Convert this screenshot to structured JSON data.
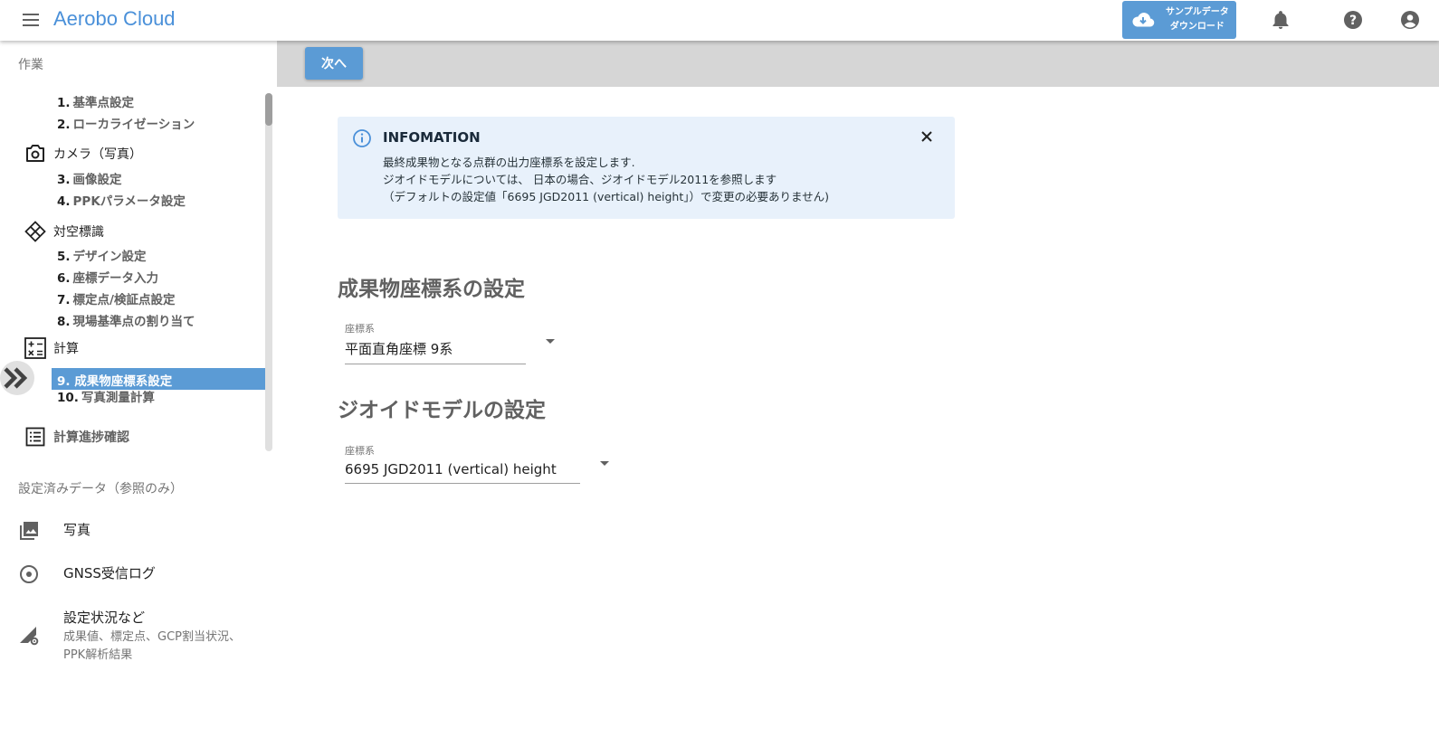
{
  "header": {
    "app_title": "Aerobo Cloud",
    "download_line1": "サンプルデータ",
    "download_line2": "ダウンロード"
  },
  "sidebar": {
    "work_label": "作業",
    "steps": [
      {
        "num": "1.",
        "label": "基準点設定"
      },
      {
        "num": "2.",
        "label": "ローカライゼーション"
      },
      {
        "num": "3.",
        "label": "画像設定"
      },
      {
        "num": "4.",
        "label": "PPKパラメータ設定"
      },
      {
        "num": "5.",
        "label": "デザイン設定"
      },
      {
        "num": "6.",
        "label": "座標データ入力"
      },
      {
        "num": "7.",
        "label": "標定点/検証点設定"
      },
      {
        "num": "8.",
        "label": "現場基準点の割り当て"
      },
      {
        "num": "9.",
        "label": "成果物座標系設定"
      },
      {
        "num": "10.",
        "label": "写真測量計算"
      }
    ],
    "groups": {
      "camera": "カメラ（写真）",
      "target": "対空標識",
      "calc": "計算",
      "progress": "計算進捗確認"
    },
    "ref_label": "設定済みデータ（参照のみ）",
    "ref_items": [
      {
        "label": "写真"
      },
      {
        "label": "GNSS受信ログ"
      },
      {
        "label": "設定状況など",
        "sub1": "成果値、標定点、GCP割当状況、",
        "sub2": "PPK解析結果"
      }
    ]
  },
  "main": {
    "next_label": "次へ",
    "info": {
      "title": "INFOMATION",
      "line1": "最終成果物となる点群の出力座標系を設定します.",
      "line2": "ジオイドモデルについては、 日本の場合、ジオイドモデル2011を参照します",
      "line3": "（デフォルトの設定値「6695 JGD2011 (vertical) height」）で変更の必要ありません)"
    },
    "section1": {
      "title": "成果物座標系の設定",
      "field_label": "座標系",
      "value": "平面直角座標 9系"
    },
    "section2": {
      "title": "ジオイドモデルの設定",
      "field_label": "座標系",
      "value": "6695 JGD2011 (vertical) height"
    }
  },
  "colors": {
    "accent": "#5b9bd5",
    "title_blue": "#4a90d9",
    "info_bg": "#e8f1fb"
  }
}
